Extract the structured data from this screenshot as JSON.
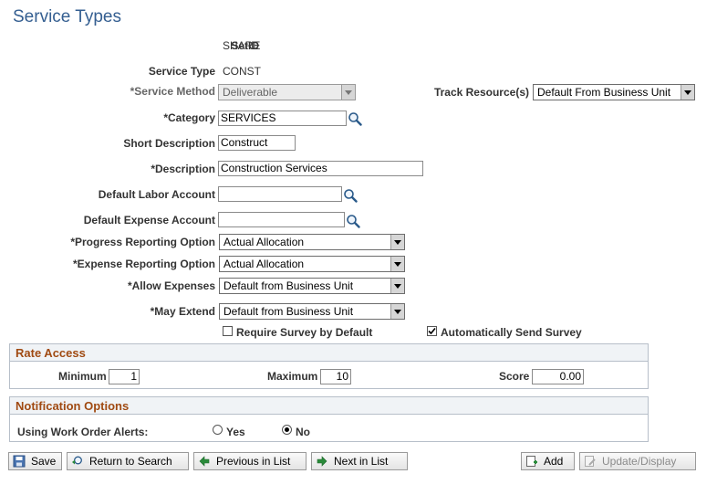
{
  "page": {
    "title": "Service Types"
  },
  "fields": {
    "setid": {
      "label": "SetID",
      "value": "SHARE"
    },
    "service_type": {
      "label": "Service Type",
      "value": "CONST"
    },
    "service_method": {
      "label": "*Service Method",
      "value": "Deliverable"
    },
    "track_resources": {
      "label": "Track Resource(s)",
      "value": "Default From Business Unit"
    },
    "category": {
      "label": "*Category",
      "value": "SERVICES"
    },
    "short_description": {
      "label": "Short Description",
      "value": "Construct"
    },
    "description": {
      "label": "*Description",
      "value": "Construction Services"
    },
    "default_labor_account": {
      "label": "Default Labor Account",
      "value": ""
    },
    "default_expense_account": {
      "label": "Default Expense Account",
      "value": ""
    },
    "progress_reporting_option": {
      "label": "*Progress Reporting Option",
      "value": "Actual Allocation"
    },
    "expense_reporting_option": {
      "label": "*Expense Reporting Option",
      "value": "Actual Allocation"
    },
    "allow_expenses": {
      "label": "*Allow Expenses",
      "value": "Default from Business Unit"
    },
    "may_extend": {
      "label": "*May Extend",
      "value": "Default from Business Unit"
    },
    "require_survey": {
      "label": "Require Survey by Default",
      "checked": false
    },
    "auto_send_survey": {
      "label": "Automatically Send Survey",
      "checked": true
    }
  },
  "rate_access": {
    "title": "Rate Access",
    "minimum": {
      "label": "Minimum",
      "value": "1"
    },
    "maximum": {
      "label": "Maximum",
      "value": "10"
    },
    "score": {
      "label": "Score",
      "value": "0.00"
    }
  },
  "notification": {
    "title": "Notification Options",
    "alerts_label": "Using Work Order Alerts:",
    "yes_label": "Yes",
    "no_label": "No",
    "selected": "No"
  },
  "toolbar": {
    "save": "Save",
    "return_to_search": "Return to Search",
    "previous_in_list": "Previous in List",
    "next_in_list": "Next in List",
    "add": "Add",
    "update_display": "Update/Display"
  },
  "colors": {
    "title": "#355f91",
    "group_header_text": "#a04a12"
  }
}
